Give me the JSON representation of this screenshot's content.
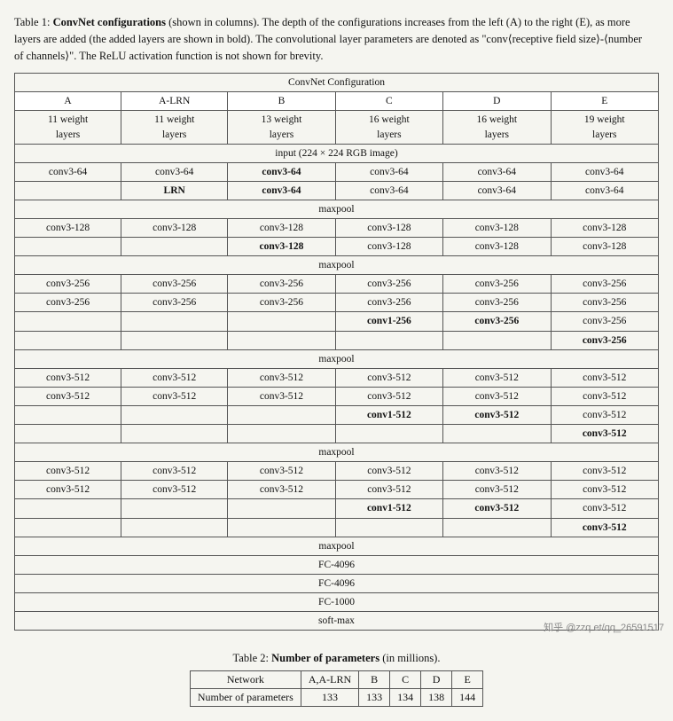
{
  "caption": {
    "label": "Table 1:",
    "title": "ConvNet configurations",
    "text": " (shown in columns). The depth of the configurations increases from the left (A) to the right (E), as more layers are added (the added layers are shown in bold). The convolutional layer parameters are denoted as \"conv⟨receptive field size⟩-⟨number of channels⟩\". The ReLU activation function is not shown for brevity."
  },
  "table1": {
    "config_header": "ConvNet Configuration",
    "columns": [
      "A",
      "A-LRN",
      "B",
      "C",
      "D",
      "E"
    ],
    "weight_layers": [
      "11 weight layers",
      "11 weight layers",
      "13 weight layers",
      "16 weight layers",
      "16 weight layers",
      "19 weight layers"
    ],
    "input_row": "input (224 × 224 RGB image)",
    "maxpool": "maxpool",
    "fc4096_1": "FC-4096",
    "fc4096_2": "FC-4096",
    "fc1000": "FC-1000",
    "softmax": "soft-max"
  },
  "table2": {
    "caption_label": "Table 2:",
    "caption_title": "Number of parameters",
    "caption_text": " (in millions).",
    "headers": [
      "Network",
      "A,A-LRN",
      "B",
      "C",
      "D",
      "E"
    ],
    "row_label": "Number of parameters",
    "values": [
      "133",
      "133",
      "134",
      "138",
      "144"
    ]
  },
  "watermark": "知乎 @zzq\net/qq_26591517"
}
